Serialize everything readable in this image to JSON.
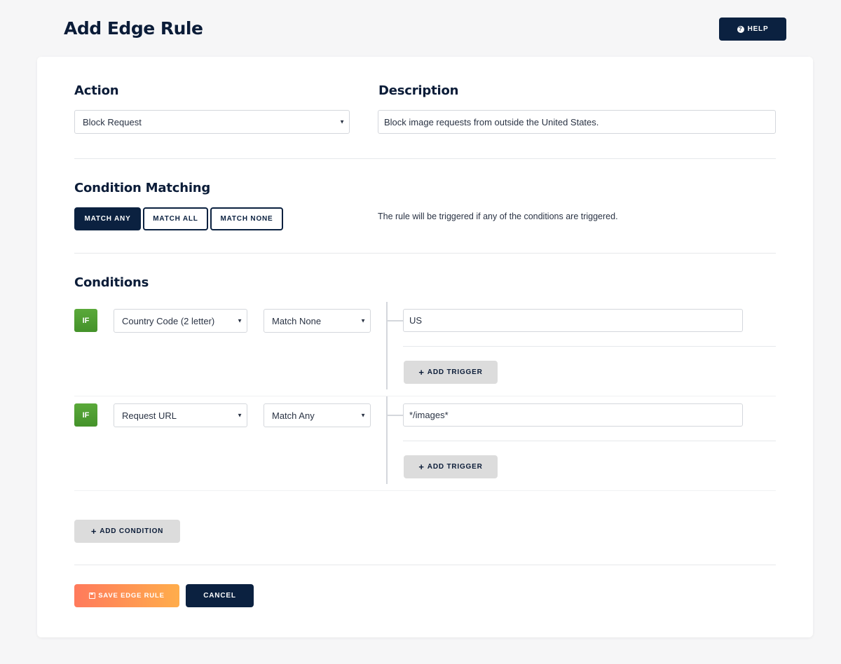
{
  "header": {
    "title": "Add Edge Rule",
    "help_label": "HELP",
    "help_icon": "question-circle-icon"
  },
  "action": {
    "heading": "Action",
    "selected": "Block Request"
  },
  "description": {
    "heading": "Description",
    "value": "Block image requests from outside the United States."
  },
  "condition_matching": {
    "heading": "Condition Matching",
    "options": [
      "MATCH ANY",
      "MATCH ALL",
      "MATCH NONE"
    ],
    "selected": "MATCH ANY",
    "helper_text": "The rule will be triggered if any of the conditions are triggered."
  },
  "conditions": {
    "heading": "Conditions",
    "items": [
      {
        "badge": "IF",
        "type": "Country Code (2 letter)",
        "match": "Match None",
        "triggers": [
          "US"
        ],
        "add_trigger_label": "ADD TRIGGER"
      },
      {
        "badge": "IF",
        "type": "Request URL",
        "match": "Match Any",
        "triggers": [
          "*/images*"
        ],
        "add_trigger_label": "ADD TRIGGER"
      }
    ],
    "add_condition_label": "ADD CONDITION"
  },
  "footer": {
    "save_label": "SAVE EDGE RULE",
    "cancel_label": "CANCEL"
  },
  "colors": {
    "navy": "#0b2140",
    "if_green": "#4e9f33",
    "save_gradient_start": "#ff7a5c",
    "save_gradient_end": "#ffad4b"
  }
}
